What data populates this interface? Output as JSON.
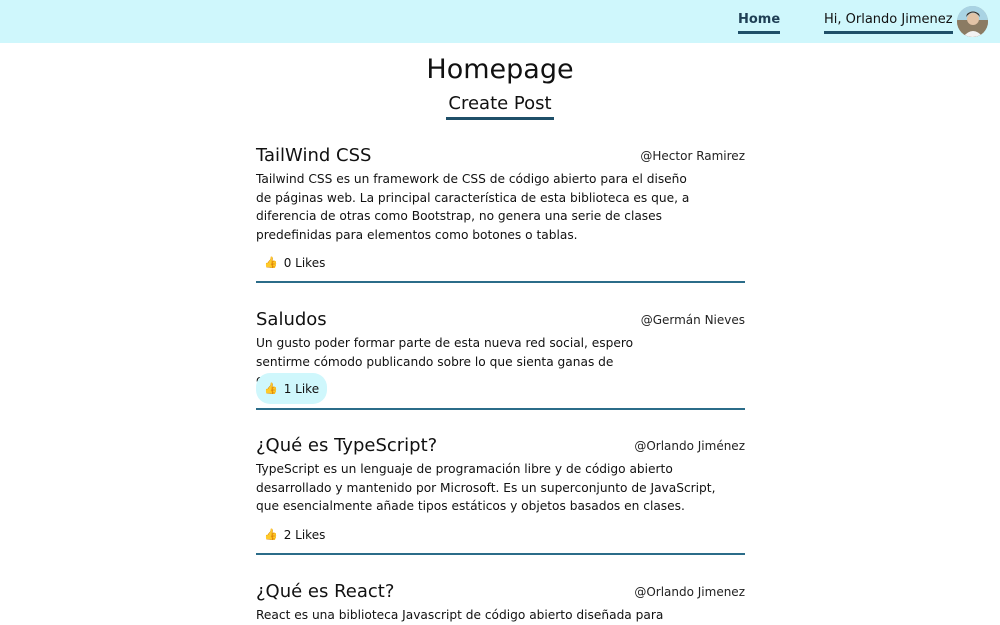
{
  "nav": {
    "home_label": "Home",
    "user_label": "Hi, Orlando Jimenez"
  },
  "page": {
    "title": "Homepage",
    "create_post_label": "Create Post"
  },
  "posts": [
    {
      "title": "TailWind CSS",
      "author": "@Hector Ramirez",
      "body": "Tailwind CSS es un framework de CSS de código abierto para el diseño de páginas web. La principal característica de esta biblioteca es que, a diferencia de otras como Bootstrap, no genera una serie de clases predefinidas para elementos como botones o tablas.",
      "likes_label": "0 Likes",
      "liked": false
    },
    {
      "title": "Saludos",
      "author": "@Germán Nieves",
      "body": "Un gusto poder formar parte de esta nueva red social, espero sentirme cómodo publicando sobre lo que sienta ganas de compartir.",
      "likes_label": "1 Like",
      "liked": true
    },
    {
      "title": "¿Qué es TypeScript?",
      "author": "@Orlando Jiménez",
      "body": "TypeScript es un lenguaje de programación libre y de código abierto desarrollado y mantenido por Microsoft. Es un superconjunto de JavaScript, que esencialmente añade tipos estáticos y objetos basados en clases.",
      "likes_label": "2 Likes",
      "liked": false
    },
    {
      "title": "¿Qué es React?",
      "author": "@Orlando Jimenez",
      "body": "React es una biblioteca Javascript de código abierto diseñada para",
      "likes_label": "",
      "liked": false
    }
  ],
  "colors": {
    "navbar_bg": "#cff7fc",
    "accent_underline": "#1f4f68",
    "post_divider": "#2b6c89",
    "liked_bg": "#cff7fc"
  },
  "icons": {
    "like": "thumbs-up-icon"
  }
}
